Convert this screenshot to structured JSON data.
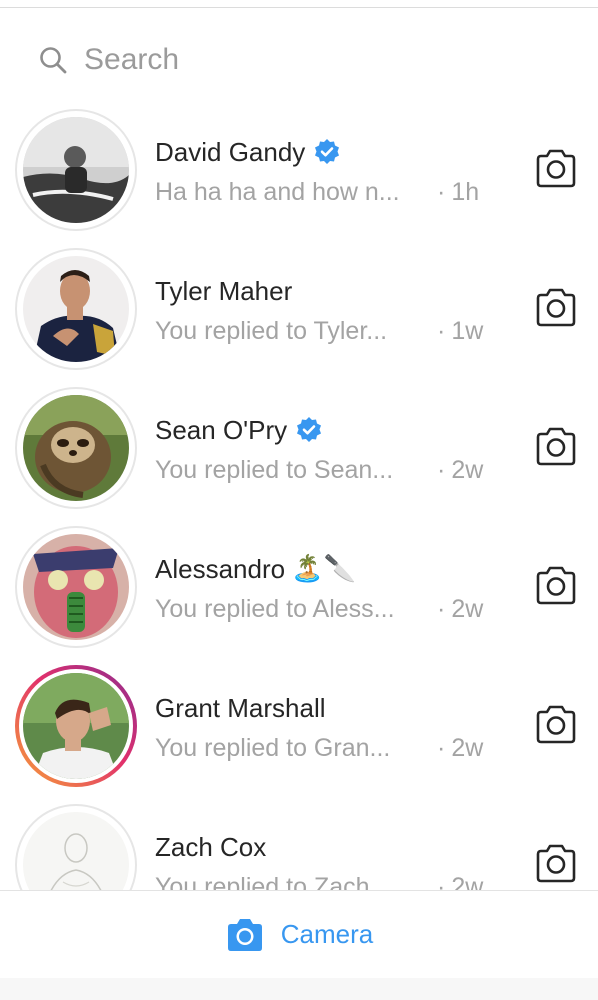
{
  "search": {
    "placeholder": "Search"
  },
  "threads": [
    {
      "name": "David Gandy",
      "verified": true,
      "emoji": "",
      "preview": "Ha ha ha and how n...",
      "time": "1h",
      "story_ring": false
    },
    {
      "name": "Tyler Maher",
      "verified": false,
      "emoji": "",
      "preview": "You replied to Tyler...",
      "time": "1w",
      "story_ring": false
    },
    {
      "name": "Sean O'Pry",
      "verified": true,
      "emoji": "",
      "preview": "You replied to Sean...",
      "time": "2w",
      "story_ring": false
    },
    {
      "name": "Alessandro",
      "verified": false,
      "emoji": "🏝️🔪",
      "preview": "You replied to Aless...",
      "time": "2w",
      "story_ring": false
    },
    {
      "name": "Grant Marshall",
      "verified": false,
      "emoji": "",
      "preview": "You replied to Gran...",
      "time": "2w",
      "story_ring": true
    },
    {
      "name": "Zach Cox",
      "verified": false,
      "emoji": "",
      "preview": "You replied to Zach...",
      "time": "2w",
      "story_ring": false
    }
  ],
  "separator": "·",
  "bottom_bar": {
    "camera_label": "Camera"
  },
  "colors": {
    "accent": "#3897f0",
    "verified": "#3897f0",
    "secondary_text": "#a3a3a3"
  }
}
